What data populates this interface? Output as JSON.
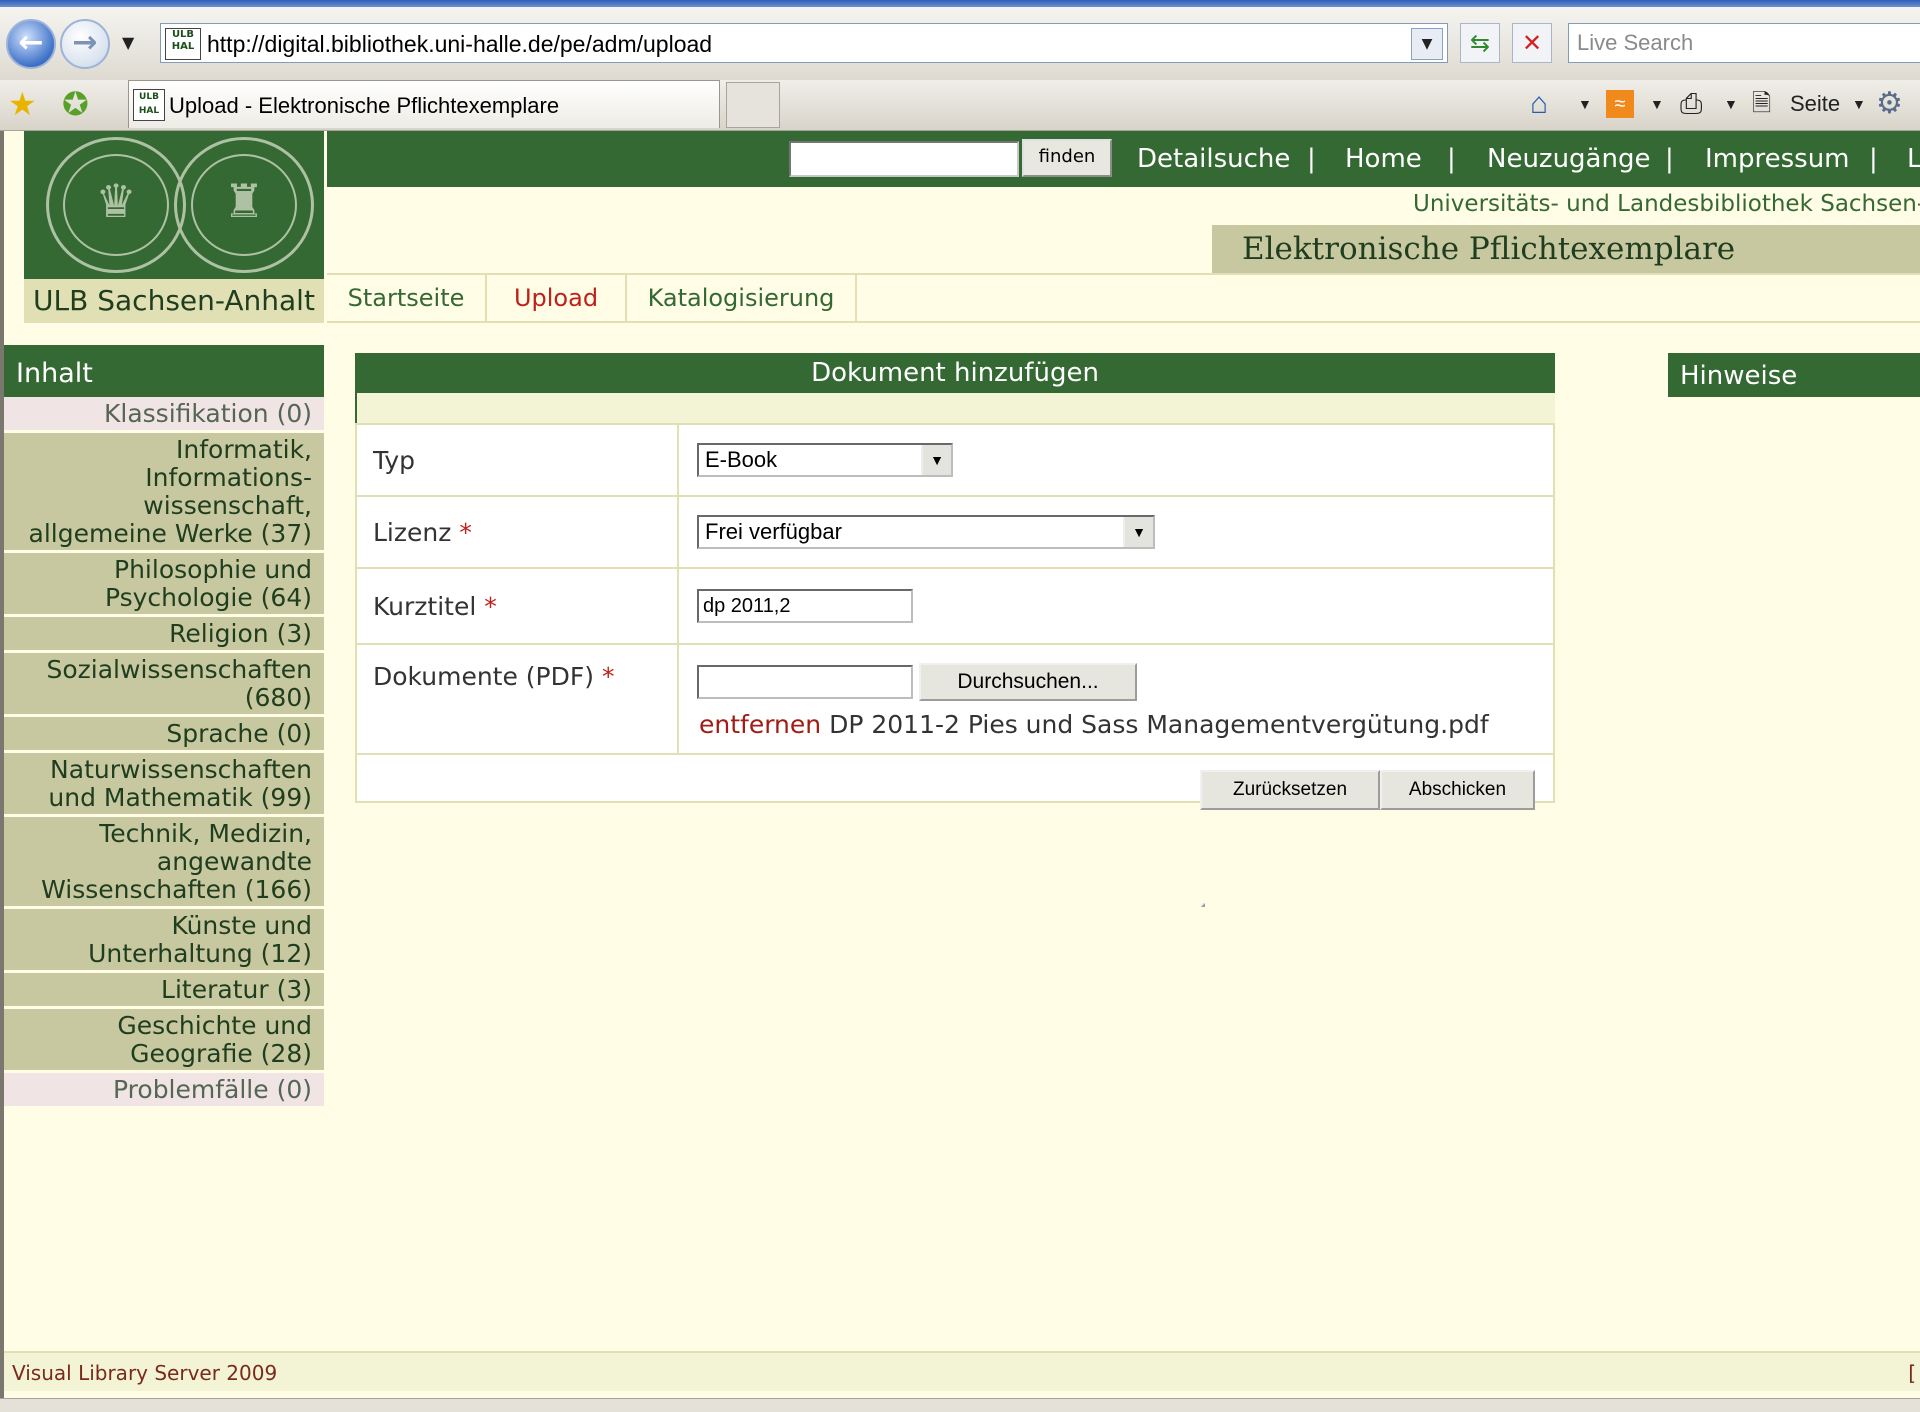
{
  "browser": {
    "url": "http://digital.bibliothek.uni-halle.de/pe/adm/upload",
    "search_placeholder": "Live Search",
    "tab_title": "Upload - Elektronische Pflichtexemplare",
    "favicon_text": "ULB HAL",
    "toolbar": {
      "page_label": "Seite"
    }
  },
  "site": {
    "library_name": "ULB Sachsen-Anhalt",
    "search_button": "finden",
    "top_nav": [
      "Detailsuche",
      "Home",
      "Neuzugänge",
      "Impressum",
      "L"
    ],
    "separator": "|",
    "institution": "Universitäts- und Landesbibliothek Sachsen-",
    "collection_title": "Elektronische Pflichtexemplare",
    "tabs": [
      {
        "label": "Startseite",
        "active": false
      },
      {
        "label": "Upload",
        "active": true
      },
      {
        "label": "Katalogisierung",
        "active": false
      }
    ]
  },
  "sidebar": {
    "title": "Inhalt",
    "items": [
      {
        "label": "Klassifikation (0)"
      },
      {
        "label": "Informatik, Informations-wissenschaft, allgemeine Werke (37)"
      },
      {
        "label": "Philosophie und Psychologie (64)"
      },
      {
        "label": "Religion (3)"
      },
      {
        "label": "Sozialwissenschaften (680)"
      },
      {
        "label": "Sprache (0)"
      },
      {
        "label": "Naturwissenschaften und Mathematik (99)"
      },
      {
        "label": "Technik, Medizin, angewandte Wissenschaften (166)"
      },
      {
        "label": "Künste und Unterhaltung (12)"
      },
      {
        "label": "Literatur (3)"
      },
      {
        "label": "Geschichte und Geografie (28)"
      },
      {
        "label": "Problemfälle (0)"
      }
    ]
  },
  "form": {
    "title": "Dokument hinzufügen",
    "required_marker": "*",
    "typ": {
      "label": "Typ",
      "value": "E-Book"
    },
    "lizenz": {
      "label": "Lizenz",
      "value": "Frei verfügbar"
    },
    "kurztitel": {
      "label": "Kurztitel",
      "value": "dp 2011,2"
    },
    "dokumente": {
      "label": "Dokumente (PDF)",
      "browse_button": "Durchsuchen...",
      "remove_link": "entfernen",
      "filename": "DP 2011-2 Pies und Sass Managementvergütung.pdf"
    },
    "reset_button": "Zurücksetzen",
    "submit_button": "Abschicken"
  },
  "hints": {
    "title": "Hinweise"
  },
  "footer": {
    "text": "Visual Library Server 2009",
    "bracket": "["
  },
  "colors": {
    "brand_green": "#356934",
    "page_bg": "#fffde6",
    "sidebar_item": "#c8c8a0",
    "required": "#c0201c"
  }
}
